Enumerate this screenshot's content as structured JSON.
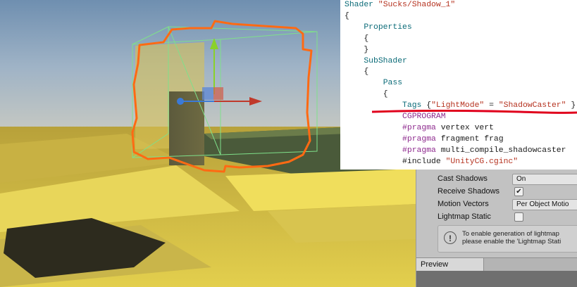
{
  "code": {
    "lines": [
      {
        "indent": 0,
        "parts": [
          {
            "t": "Shader ",
            "c": "kw"
          },
          {
            "t": "\"Sucks/Shadow_1\"",
            "c": "str"
          }
        ]
      },
      {
        "indent": 0,
        "parts": [
          {
            "t": "{",
            "c": "pl"
          }
        ]
      },
      {
        "indent": 1,
        "parts": [
          {
            "t": "Properties",
            "c": "kw"
          }
        ]
      },
      {
        "indent": 1,
        "parts": [
          {
            "t": "{",
            "c": "pl"
          }
        ]
      },
      {
        "indent": 1,
        "parts": [
          {
            "t": "}",
            "c": "pl"
          }
        ]
      },
      {
        "indent": 1,
        "parts": [
          {
            "t": "SubShader",
            "c": "kw"
          }
        ]
      },
      {
        "indent": 1,
        "parts": [
          {
            "t": "{",
            "c": "pl"
          }
        ]
      },
      {
        "indent": 2,
        "parts": [
          {
            "t": "Pass",
            "c": "kw"
          }
        ]
      },
      {
        "indent": 2,
        "parts": [
          {
            "t": "{",
            "c": "pl"
          }
        ]
      },
      {
        "indent": 3,
        "parts": [
          {
            "t": "Tags ",
            "c": "kw"
          },
          {
            "t": "{",
            "c": "pl"
          },
          {
            "t": "\"LightMode\"",
            "c": "str"
          },
          {
            "t": " = ",
            "c": "pl"
          },
          {
            "t": "\"ShadowCaster\"",
            "c": "str"
          },
          {
            "t": " }",
            "c": "pl"
          }
        ]
      },
      {
        "indent": 3,
        "parts": [
          {
            "t": "CGPROGRAM",
            "c": "cg"
          }
        ]
      },
      {
        "indent": 3,
        "parts": [
          {
            "t": "#pragma",
            "c": "pp"
          },
          {
            "t": " vertex vert",
            "c": "pl"
          }
        ]
      },
      {
        "indent": 3,
        "parts": [
          {
            "t": "#pragma",
            "c": "pp"
          },
          {
            "t": " fragment frag",
            "c": "pl"
          }
        ]
      },
      {
        "indent": 3,
        "parts": [
          {
            "t": "#pragma",
            "c": "pp"
          },
          {
            "t": " multi_compile_shadowcaster",
            "c": "pl"
          }
        ]
      },
      {
        "indent": 3,
        "parts": [
          {
            "t": "#include ",
            "c": "pl"
          },
          {
            "t": "\"UnityCG.cginc\"",
            "c": "str"
          }
        ]
      }
    ],
    "colors": {
      "keyword": "#0b6b78",
      "string": "#b5321f",
      "preprocessor": "#8e2a8e",
      "underline": "#e0001c"
    }
  },
  "inspector": {
    "cast_shadows": {
      "label": "Cast Shadows",
      "value": "On"
    },
    "receive_shadows": {
      "label": "Receive Shadows",
      "checked": "✔"
    },
    "motion_vectors": {
      "label": "Motion Vectors",
      "value": "Per Object Motio"
    },
    "lightmap_static": {
      "label": "Lightmap Static",
      "checked": ""
    },
    "info_icon": "!",
    "info_line1": "To enable generation of lightmap",
    "info_line2": "please enable the 'Lightmap Stati",
    "preview_tab": "Preview"
  },
  "scene": {
    "sky_color": "#8fa7bf",
    "floor_color": "#d9c64a",
    "selection_color": "#ff6a13",
    "gizmo_colors": {
      "x": "#c0392b",
      "y": "#8ad12a",
      "z": "#3b7ad8"
    }
  }
}
